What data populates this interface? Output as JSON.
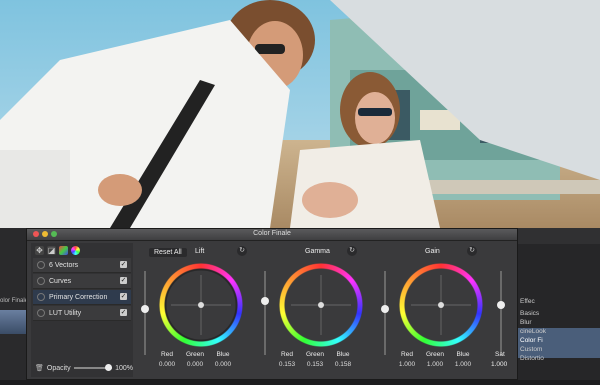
{
  "window": {
    "title": "Color Finale"
  },
  "toolbar": {
    "reset_all": "Reset All"
  },
  "layers": [
    {
      "label": "6 Vectors",
      "checked": true
    },
    {
      "label": "Curves",
      "checked": true
    },
    {
      "label": "Primary Correction",
      "checked": true
    },
    {
      "label": "LUT Utility",
      "checked": true
    }
  ],
  "opacity": {
    "label": "Opacity",
    "value": "100%"
  },
  "wheels": {
    "lift": {
      "title": "Lift",
      "labels": [
        "Red",
        "Green",
        "Blue"
      ],
      "values": [
        "0.000",
        "0.000",
        "0.000"
      ]
    },
    "gamma": {
      "title": "Gamma",
      "labels": [
        "Red",
        "Green",
        "Blue"
      ],
      "values": [
        "0.153",
        "0.153",
        "0.158"
      ]
    },
    "gain": {
      "title": "Gain",
      "labels": [
        "Red",
        "Green",
        "Blue"
      ],
      "values": [
        "1.000",
        "1.000",
        "1.000"
      ]
    },
    "sat": {
      "label": "Sat",
      "value": "1.000"
    }
  },
  "left_strip": {
    "label": "olor Finale"
  },
  "right_strip": {
    "title": "Effec",
    "items": [
      "Basics",
      "Blur",
      "cineLook",
      "Color Fi",
      "Custom",
      "Distortio"
    ]
  }
}
